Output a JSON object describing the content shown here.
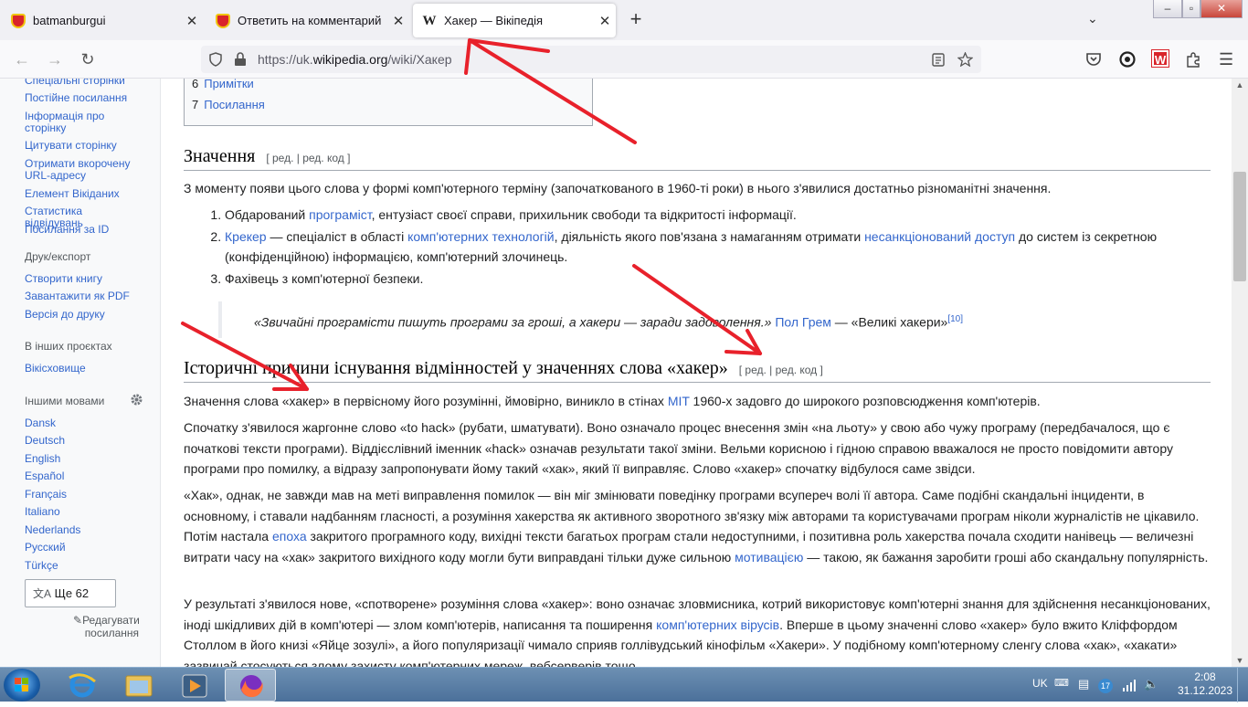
{
  "tabs": [
    {
      "title": "batmanburgui",
      "icon": "heart-favicon"
    },
    {
      "title": "Ответить на комментарий",
      "icon": "heart-favicon"
    },
    {
      "title": "Хакер — Вікіпедія",
      "icon": "wikipedia-favicon",
      "active": true
    }
  ],
  "browser": {
    "url_prefix": "https://uk.",
    "url_host": "wikipedia.org",
    "url_path": "/wiki/Хакер"
  },
  "sidebar": {
    "tools": [
      "Спеціальні сторінки",
      "Постійне посилання",
      "Інформація про сторінку",
      "Цитувати сторінку",
      "Отримати вкорочену URL-адресу",
      "Елемент Вікіданих",
      "Статистика відвідувань",
      "Посилання за ID"
    ],
    "print_heading": "Друк/експорт",
    "print": [
      "Створити книгу",
      "Завантажити як PDF",
      "Версія до друку"
    ],
    "projects_heading": "В інших проєктах",
    "projects": [
      "Вікісховище"
    ],
    "languages_heading": "Іншими мовами",
    "languages": [
      "Dansk",
      "Deutsch",
      "English",
      "Español",
      "Français",
      "Italiano",
      "Nederlands",
      "Русский",
      "Türkçe"
    ],
    "more_languages": "Ще 62",
    "edit_links": "Редагувати посилання"
  },
  "toc": [
    {
      "num": "6",
      "label": "Примітки"
    },
    {
      "num": "7",
      "label": "Посилання"
    }
  ],
  "section1": {
    "title": "Значення",
    "edit": "[ ред. | ред. код ]",
    "intro": "З моменту появи цього слова у формі комп'ютерного терміну (започаткованого в 1960-ті роки) в нього з'явилися достатньо різноманітні значення.",
    "item1_a": "Обдарований ",
    "item1_link": "програміст",
    "item1_b": ", ентузіаст своєї справи, прихильник свободи та відкритості інформації.",
    "item2_link1": "Крекер",
    "item2_a": " — спеціаліст в області ",
    "item2_link2": "комп'ютерних технологій",
    "item2_b": ", діяльність якого пов'язана з намаганням отримати ",
    "item2_link3": "несанкціонований доступ",
    "item2_c": " до систем із секретною (конфіденційною) інформацією, комп'ютерний злочинець.",
    "item3": "Фахівець з комп'ютерної безпеки.",
    "quote": "«Звичайні програмісти пишуть програми за гроші, а хакери — заради задоволення.»",
    "quote_author": "Пол Грем",
    "quote_source": " — «Великі хакери»",
    "quote_ref": "[10]"
  },
  "section2": {
    "title": "Історичні причини існування відмінностей у значеннях слова «хакер»",
    "edit": "[ ред. | ред. код ]",
    "p1_a": "Значення слова «хакер» в первісному його розумінні, ймовірно, виникло в стінах ",
    "p1_link": "MIT",
    "p1_b": " 1960-х задовго до широкого розповсюдження комп'ютерів.",
    "p2": "Спочатку з'явилося жаргонне слово «to hack» (рубати, шматувати). Воно означало процес внесення змін «на льоту» у свою або чужу програму (передбачалося, що є початкові тексти програми). Віддієслівний іменник «hack» означав результати такої зміни. Вельми корисною і гідною справою вважалося не просто повідомити автору програми про помилку, а відразу запропонувати йому такий «хак», який її виправляє. Слово «хакер» спочатку відбулося саме звідси.",
    "p3_a": "«Хак», однак, не завжди мав на меті виправлення помилок — він міг змінювати поведінку програми всупереч волі її автора. Саме подібні скандальні інциденти, в основному, і ставали надбанням гласності, а розуміння хакерства як активного зворотного зв'язку між авторами та користувачами програм ніколи журналістів не цікавило. Потім настала ",
    "p3_link1": "епоха",
    "p3_b": " закритого програмного коду, вихідні тексти багатьох програм стали недоступними, і позитивна роль хакерства почала сходити нанівець — величезні витрати часу на «хак» закритого вихідного коду могли бути виправдані тільки дуже сильною ",
    "p3_link2": "мотивацією",
    "p3_c": " — такою, як бажання заробити гроші або скандальну популярність.",
    "p4_a": "У результаті з'явилося нове, «спотворене» розуміння слова «хакер»: воно означає зловмисника, котрий використовує комп'ютерні знання для здійснення несанкціонованих, іноді шкідливих дій в комп'ютері — злом комп'ютерів, написання та поширення ",
    "p4_link": "комп'ютерних вірусів",
    "p4_b": ". Вперше в цьому значенні слово «хакер» було вжито Кліффордом Столлом в його книзі «Яйце зозулі», а його популяризації чимало сприяв голлівудський кінофільм «Хакери». У подібному комп'ютерному сленгу слова «хак», «хакати» зазвичай стосуються злому захисту комп'ютерних мереж, вебсерверів тощо."
  },
  "taskbar": {
    "lang": "UK",
    "time": "2:08",
    "date": "31.12.2023",
    "badge": "17"
  },
  "colors": {
    "link": "#3366cc",
    "annotation": "#e8212b",
    "taskbar": "#4b709a"
  }
}
